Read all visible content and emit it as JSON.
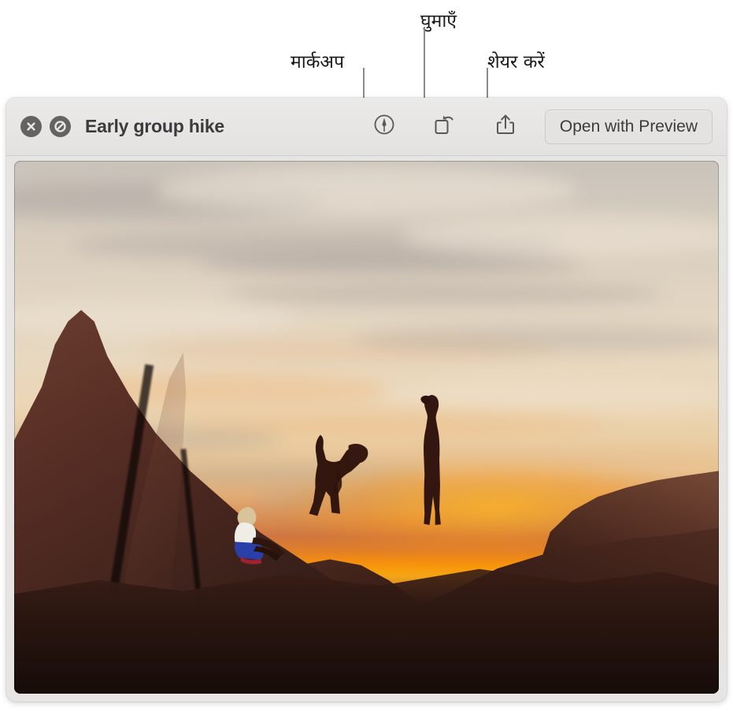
{
  "annotations": [
    {
      "id": "markup",
      "label": "मार्कअप",
      "target_icon": "markup-icon"
    },
    {
      "id": "rotate",
      "label": "घुमाएँ",
      "target_icon": "rotate-icon"
    },
    {
      "id": "share",
      "label": "शेयर करें",
      "target_icon": "share-icon"
    }
  ],
  "window": {
    "title": "Early group hike",
    "toolbar": {
      "close_button": {
        "name": "close-icon",
        "aria": "Close"
      },
      "markup_toggle": {
        "name": "slash-circle-icon",
        "aria": "Markup"
      },
      "markup_button": {
        "name": "markup-icon",
        "aria": "Markup"
      },
      "rotate_button": {
        "name": "rotate-icon",
        "aria": "Rotate"
      },
      "share_button": {
        "name": "share-icon",
        "aria": "Share"
      },
      "open_with_label": "Open with Preview"
    }
  },
  "photo": {
    "alt": "Three hikers silhouetted on red sandstone rocks at sunset",
    "caption": "Early group hike"
  },
  "colors": {
    "window_bg": "#e6e5e3",
    "toolbar_bg": "#eae9e7",
    "title_text": "#3b3b3d",
    "button_border": "#cbcac8",
    "leader_line": "#8a8a8e",
    "label_text": "#19191b",
    "circle_button": "#636363",
    "sunset_orange": "#f89a0a",
    "sky_beige": "#e3d6c2",
    "rock_brown": "#542c23"
  }
}
